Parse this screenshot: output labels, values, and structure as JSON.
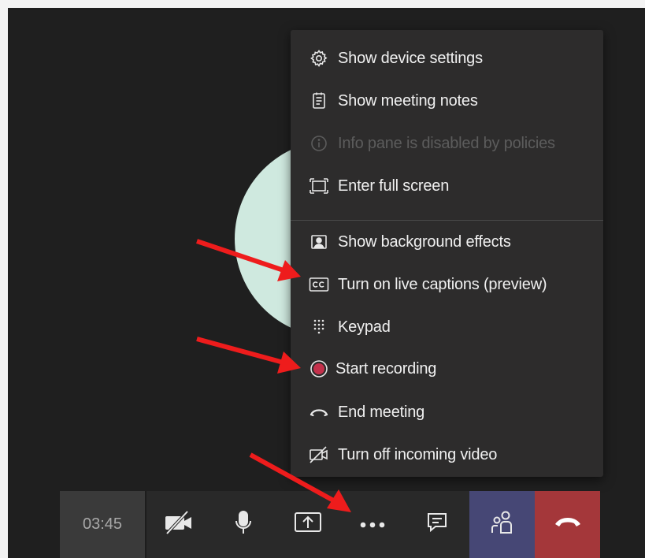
{
  "menu": {
    "items": [
      {
        "label": "Show device settings",
        "icon": "gear-icon",
        "enabled": true
      },
      {
        "label": "Show meeting notes",
        "icon": "notes-icon",
        "enabled": true
      },
      {
        "label": "Info pane is disabled by policies",
        "icon": "info-icon",
        "enabled": false
      },
      {
        "label": "Enter full screen",
        "icon": "fullscreen-icon",
        "enabled": true
      },
      {
        "label": "Show background effects",
        "icon": "background-effects-icon",
        "enabled": true
      },
      {
        "label": "Turn on live captions (preview)",
        "icon": "cc-icon",
        "enabled": true
      },
      {
        "label": "Keypad",
        "icon": "keypad-icon",
        "enabled": true
      },
      {
        "label": "Start recording",
        "icon": "record-icon",
        "enabled": true
      },
      {
        "label": "End meeting",
        "icon": "end-meeting-icon",
        "enabled": true
      },
      {
        "label": "Turn off incoming video",
        "icon": "video-off-icon",
        "enabled": true
      }
    ]
  },
  "toolbar": {
    "timer": "03:45",
    "buttons": [
      "camera-off-icon",
      "microphone-icon",
      "share-screen-icon",
      "more-options-icon",
      "chat-icon",
      "participants-icon",
      "hang-up-icon"
    ]
  },
  "colors": {
    "stage": "#1f1f1f",
    "menu": "#2d2c2c",
    "people_button": "#464775",
    "hangup_button": "#a4373a",
    "record": "#c4314b",
    "arrow": "#ee1c1c",
    "avatar": "#cfe9df"
  }
}
